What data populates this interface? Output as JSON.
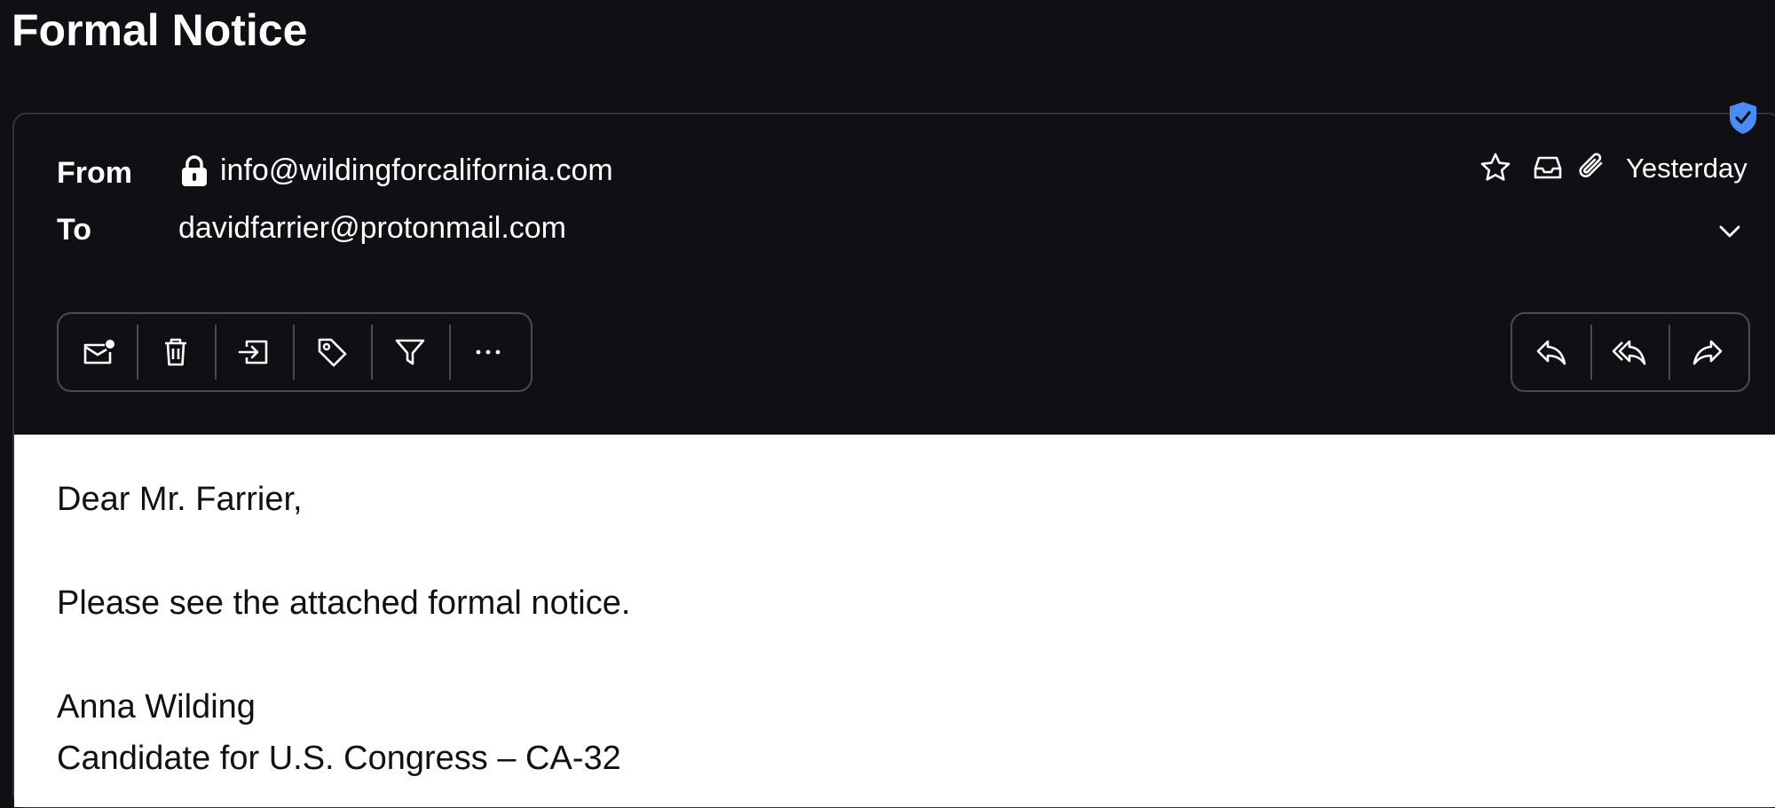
{
  "message": {
    "subject": "Formal Notice",
    "from_label": "From",
    "from_address": "info@wildingforcalifornia.com",
    "to_label": "To",
    "to_address": "davidfarrier@protonmail.com",
    "date": "Yesterday"
  },
  "header_icons": [
    "star-icon",
    "inbox-icon",
    "paperclip-icon",
    "chevron-down-icon",
    "verified-shield-icon",
    "lock-icon"
  ],
  "toolbar_left": [
    "mark-unread-icon",
    "trash-icon",
    "move-to-icon",
    "label-icon",
    "filter-icon",
    "more-icon"
  ],
  "toolbar_right": [
    "reply-icon",
    "reply-all-icon",
    "forward-icon"
  ],
  "body": {
    "greeting": "Dear Mr. Farrier,",
    "paragraph": "Please see the attached formal notice.",
    "signature_name": "Anna Wilding",
    "signature_title": "Candidate for U.S. Congress – CA-32"
  },
  "colors": {
    "background": "#0f0f14",
    "verified_badge": "#4a8cf7",
    "body_background": "#ffffff"
  }
}
